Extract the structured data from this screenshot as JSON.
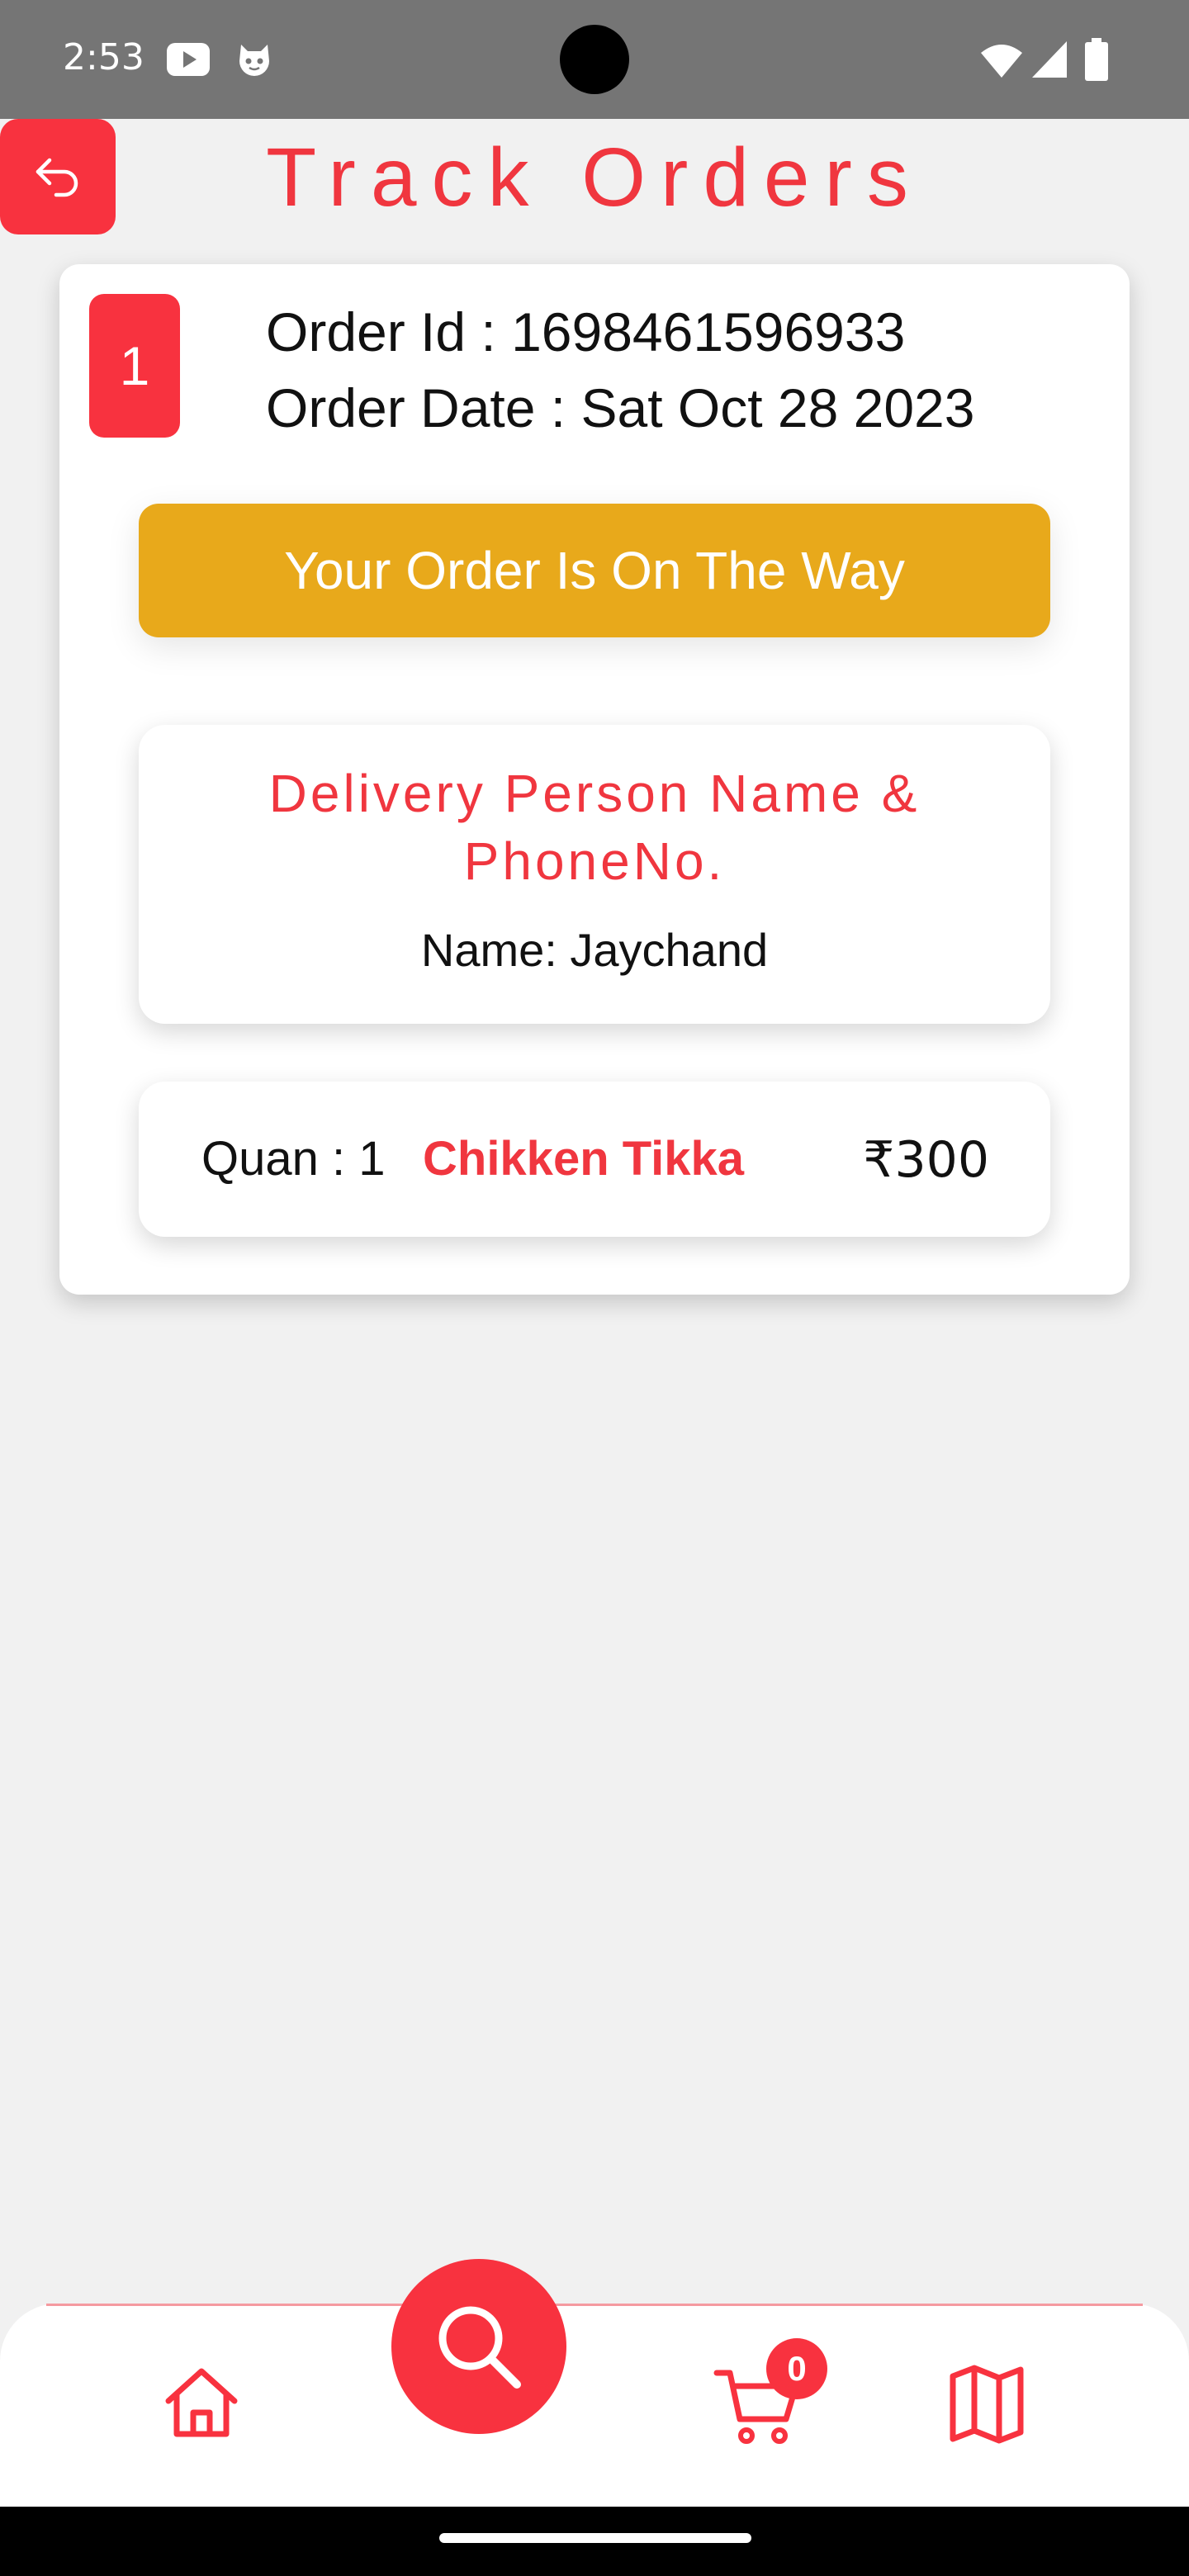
{
  "status_bar": {
    "time": "2:53",
    "icons": [
      "youtube-icon",
      "cat-notification-icon",
      "wifi-icon",
      "cell-signal-icon",
      "battery-icon"
    ]
  },
  "header": {
    "title": "Track Orders",
    "back_icon": "undo-arrow-icon"
  },
  "order": {
    "index": "1",
    "order_id_text": "Order Id : 1698461596933",
    "order_date_text": "Order Date : Sat Oct 28 2023",
    "status_text": "Your Order Is On The Way",
    "delivery": {
      "heading": "Delivery Person Name & PhoneNo.",
      "name_text": "Name: Jaychand"
    },
    "items": [
      {
        "quantity_text": "Quan : 1",
        "name": "Chikken Tikka",
        "price": "₹300"
      }
    ]
  },
  "bottom_nav": {
    "items": [
      "home-icon",
      "search-icon",
      "cart-icon",
      "map-icon"
    ],
    "cart_count": "0"
  },
  "colors": {
    "accent": "#f8323f",
    "status_banner": "#e8a91b",
    "background": "#f1f1f1",
    "status_bar": "#757575"
  }
}
